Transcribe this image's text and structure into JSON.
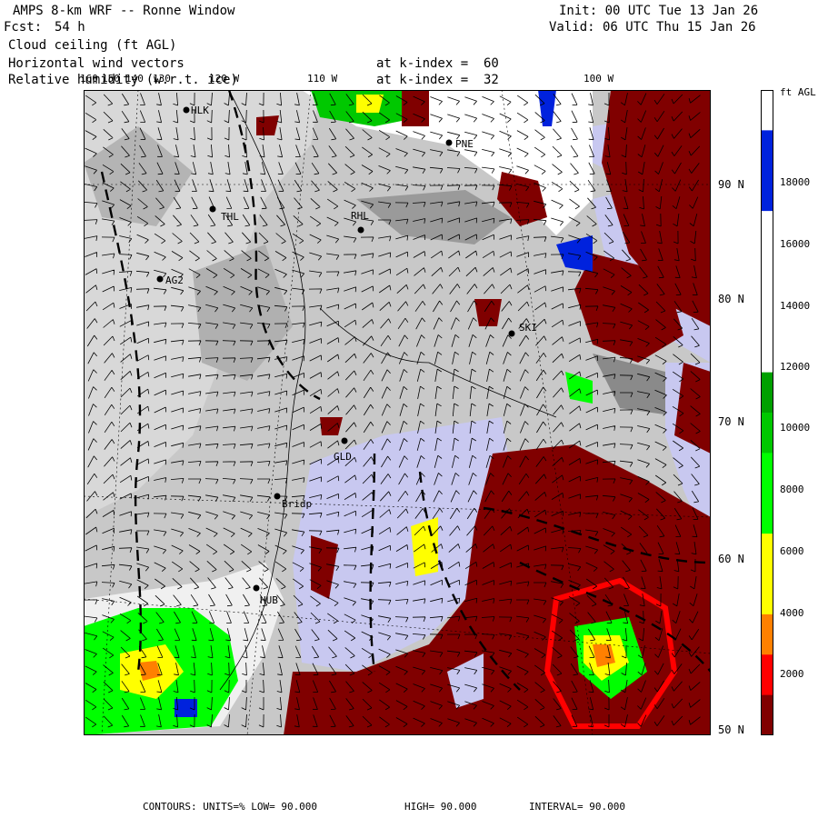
{
  "header": {
    "model": "AMPS 8-km WRF -- Ronne Window",
    "fcst_label": "Fcst:",
    "fcst_value": "54 h",
    "init": "Init: 00 UTC Tue 13 Jan 26",
    "valid": "Valid: 06 UTC Thu 15 Jan 26",
    "field1": "Cloud ceiling (ft AGL)",
    "field2": "Horizontal wind vectors",
    "field3": "Relative humidity (w.r.t. ice)",
    "level1": "at k-index =  60",
    "level2": "at k-index =  32"
  },
  "colorbar": {
    "units": "ft AGL",
    "labels": [
      "18000",
      "16000",
      "14000",
      "12000",
      "10000",
      "8000",
      "6000",
      "4000",
      "2000"
    ],
    "colors": [
      "#ffffff",
      "#0022dd",
      "#0022dd",
      "#ffffff",
      "#ffffff",
      "#ffffff",
      "#ffffff",
      "#00a000",
      "#00c800",
      "#00ff00",
      "#00ff00",
      "#ffff00",
      "#ffff00",
      "#ff8000",
      "#ff0000",
      "#800000"
    ]
  },
  "latitudes": [
    "90 N",
    "80 N",
    "70 N",
    "60 N",
    "50 N"
  ],
  "longitudes": [
    "160",
    "150",
    "140",
    "130",
    "120 W",
    "110 W",
    "100 W"
  ],
  "stations": [
    "HLK",
    "PNE",
    "THL",
    "RHL",
    "AG2",
    "SKI",
    "GLD",
    "Bridp",
    "HUB"
  ],
  "footer": {
    "contours": "CONTOURS: UNITS=% LOW= 90.000",
    "high": "HIGH= 90.000",
    "interval": "INTERVAL= 90.000"
  }
}
